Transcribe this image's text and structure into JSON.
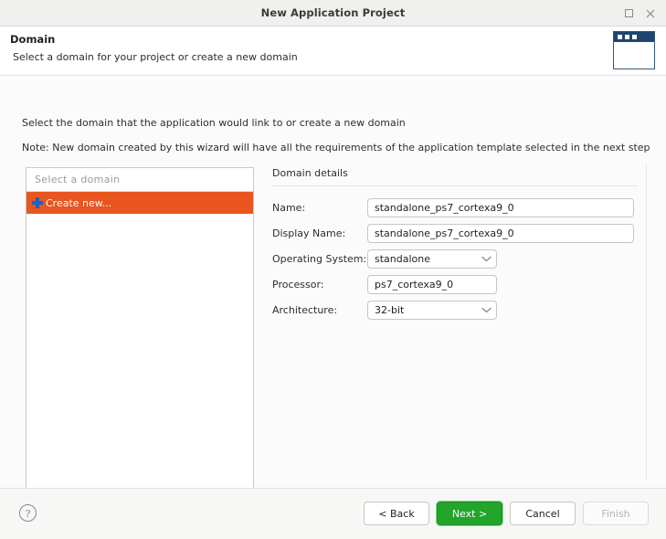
{
  "titlebar": {
    "title": "New Application Project",
    "maximize_icon": "maximize-icon",
    "close_icon": "close-icon"
  },
  "wizard_header": {
    "title": "Domain",
    "subtitle": "Select a domain for your project or create a new domain",
    "banner_icon": "wizard-window-icon"
  },
  "instructions": {
    "line1": "Select the domain that the application would link to or create a new domain",
    "line2": "Note: New domain created by this wizard will have all the requirements of the application template selected in the next step"
  },
  "domain_list": {
    "header": "Select a domain",
    "items": [
      {
        "label": "Create new...",
        "icon": "plus-icon",
        "selected": true
      }
    ]
  },
  "domain_details": {
    "title": "Domain details",
    "fields": [
      {
        "label": "Name:",
        "value": "standalone_ps7_cortexa9_0",
        "type": "text"
      },
      {
        "label": "Display Name:",
        "value": "standalone_ps7_cortexa9_0",
        "type": "text"
      },
      {
        "label": "Operating System:",
        "value": "standalone",
        "type": "select"
      },
      {
        "label": "Processor:",
        "value": "ps7_cortexa9_0",
        "type": "text"
      },
      {
        "label": "Architecture:",
        "value": "32-bit",
        "type": "select"
      }
    ]
  },
  "footer": {
    "help_icon": "help-icon",
    "help_glyph": "?",
    "buttons": [
      {
        "label": "< Back",
        "state": "enabled"
      },
      {
        "label": "Next >",
        "state": "primary"
      },
      {
        "label": "Cancel",
        "state": "enabled"
      },
      {
        "label": "Finish",
        "state": "disabled"
      }
    ]
  },
  "colors": {
    "selection_orange": "#e8551f",
    "primary_green": "#22a52a",
    "plus_blue": "#1d62c4",
    "banner_blue": "#1e4570"
  }
}
